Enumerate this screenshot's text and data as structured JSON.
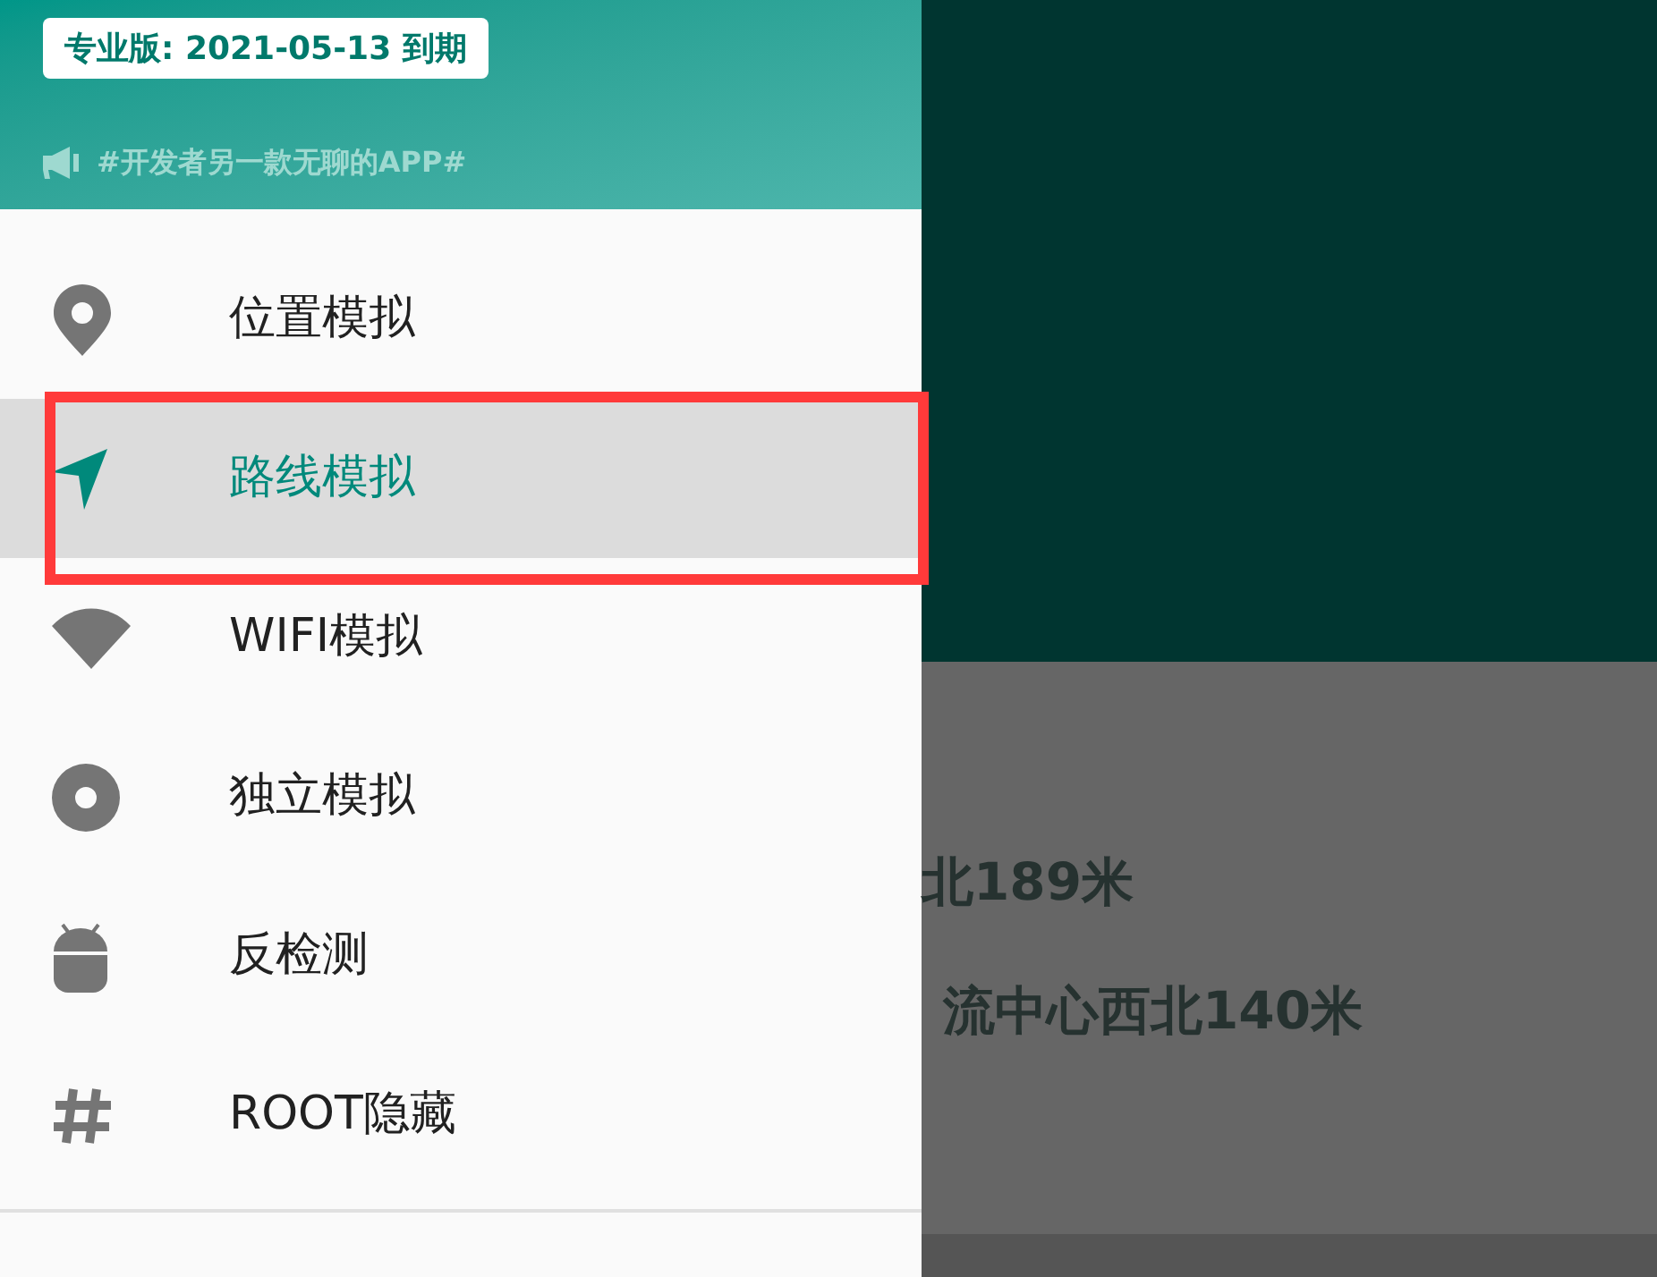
{
  "drawer": {
    "badge": "专业版: 2021-05-13 到期",
    "slogan": "#开发者另一款无聊的APP#",
    "items": [
      {
        "label": "位置模拟",
        "selected": false
      },
      {
        "label": "路线模拟",
        "selected": true
      },
      {
        "label": "WIFI模拟",
        "selected": false
      },
      {
        "label": "独立模拟",
        "selected": false
      },
      {
        "label": "反检测",
        "selected": false
      },
      {
        "label": "ROOT隐藏",
        "selected": false
      }
    ]
  },
  "background": {
    "lines": [
      "北189米",
      "流中心西北140米"
    ]
  }
}
